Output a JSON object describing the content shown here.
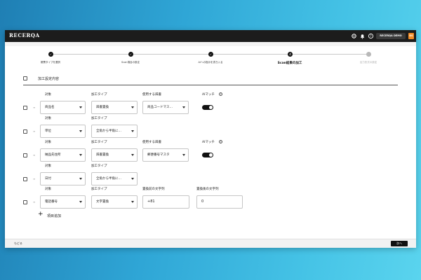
{
  "app": {
    "logo": "RECERQA",
    "user_name": "RECERQA DEMO",
    "user_initials": "DS"
  },
  "stepper": {
    "steps": [
      {
        "label": "帳票タイプを選択",
        "status": "done"
      },
      {
        "label": "Scan項目の設定",
        "status": "done"
      },
      {
        "label": "AIへの指示を書き入る",
        "status": "done"
      },
      {
        "label": "Scan結果の加工",
        "status": "current",
        "marker": "4"
      },
      {
        "label": "出力形式の設定",
        "status": "pending"
      }
    ]
  },
  "section": {
    "header_label": "加工設定内容"
  },
  "labels": {
    "target": "対象",
    "process_type": "加工タイプ",
    "dictionary": "使用する辞書",
    "ai_match": "AIマッチ",
    "before_replace": "置換前の文字列",
    "after_replace": "置換後の文字列"
  },
  "rows": [
    {
      "target": "商品名",
      "process_type": "辞書置換",
      "dictionary": "商品コードマス…",
      "ai_match": true
    },
    {
      "target": "単位",
      "process_type": "全角から半角に…"
    },
    {
      "target": "納品先住所",
      "process_type": "辞書置換",
      "dictionary": "郵便番号マスタ",
      "ai_match": true
    },
    {
      "target": "日付",
      "process_type": "全角から半角に…"
    },
    {
      "target": "電話番号",
      "process_type": "文字置換",
      "before": "+81",
      "after": "0"
    }
  ],
  "actions": {
    "add_item": "項目追加",
    "back": "もどる",
    "next": "次へ"
  }
}
